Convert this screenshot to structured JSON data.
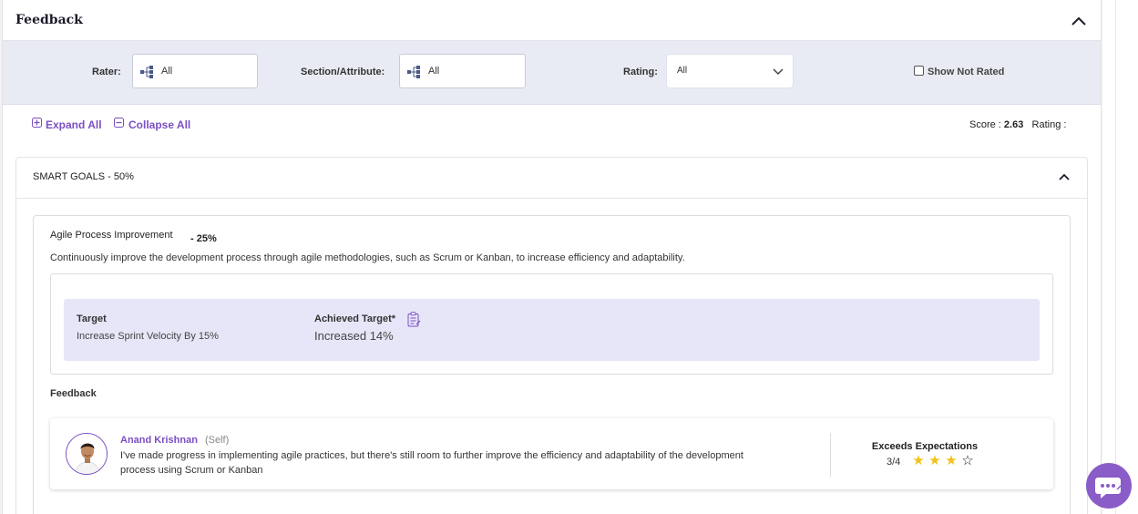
{
  "panel": {
    "title": "Feedback"
  },
  "filters": {
    "rater_label": "Rater:",
    "rater_value": "All",
    "section_label": "Section/Attribute:",
    "section_value": "All",
    "rating_label": "Rating:",
    "rating_value": "All",
    "show_not_rated_label": "Show Not Rated",
    "show_not_rated_checked": false
  },
  "toolbar": {
    "expand_all": "Expand All",
    "collapse_all": "Collapse All",
    "score_label": "Score :",
    "score_value": "2.63",
    "rating_label": "Rating :"
  },
  "section": {
    "title": "SMART GOALS - 50%",
    "goal": {
      "title": "Agile Process Improvement",
      "weight": "- 25%",
      "description": "Continuously improve the development process through agile methodologies, such as Scrum or Kanban, to increase efficiency and adaptability.",
      "target_label": "Target",
      "target_value": "Increase Sprint Velocity By 15%",
      "achieved_label": "Achieved Target*",
      "achieved_value": "Increased 14%",
      "feedback_heading": "Feedback",
      "feedback": {
        "name": "Anand Krishnan",
        "role": "(Self)",
        "text": "I've made progress in implementing agile practices, but there's still room to further improve the efficiency and adaptability of the development process using Scrum or Kanban",
        "rating_label": "Exceeds Expectations",
        "rating_score": "3/4",
        "rating_value": 3,
        "rating_max": 4
      }
    }
  },
  "colors": {
    "accent": "#7b4fc2",
    "filter_bg": "#e8ebf4",
    "target_bg": "#e6e6f8",
    "star": "#f2c21b"
  },
  "icons": {
    "collapse": "chevron-up-icon",
    "tree": "hierarchy-icon",
    "select": "chevron-down-icon",
    "expand": "plus-square-icon",
    "collapse_all": "minus-square-icon",
    "achieved": "clipboard-icon",
    "chat": "chat-bubble-icon"
  }
}
